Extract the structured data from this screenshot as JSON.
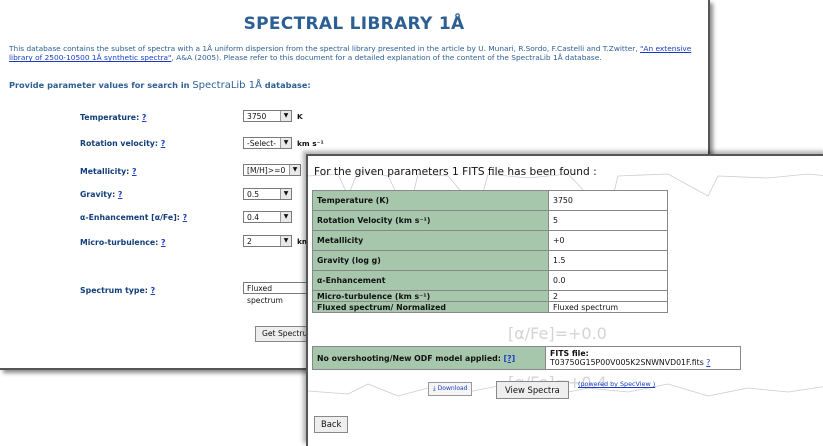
{
  "library": {
    "title": "SPECTRAL LIBRARY 1Å",
    "intro_prefix": "This database contains the subset of spectra with a 1Å uniform dispersion from the spectral library presented in the article by U. Munari, R.Sordo, F.Castelli and T.Zwitter,",
    "intro_link": "\"An extensive library of 2500-10500 1Å synthetic spectra\"",
    "intro_suffix": ", A&A (2005). Please refer to this document for a detailed explanation of the content of the SpectraLib 1Å database.",
    "prompt_prefix": "Provide parameter values for search in ",
    "prompt_lib": "SpectraLib 1Å",
    "prompt_suffix": " database:",
    "help_mark": "?",
    "params": [
      {
        "label": "Temperature:",
        "value": "3750",
        "unit": "K"
      },
      {
        "label": "Rotation velocity:",
        "value": "-Select-",
        "unit": "km s⁻¹"
      },
      {
        "label": "Metallicity:",
        "value": "[M/H]>=0",
        "unit": ""
      },
      {
        "label": "Gravity:",
        "value": "0.5",
        "unit": ""
      },
      {
        "label": "α-Enhancement [α/Fe]:",
        "value": "0.4",
        "unit": ""
      },
      {
        "label": "Micro-turbulence:",
        "value": "2",
        "unit": "km"
      },
      {
        "label": "Spectrum type:",
        "value": "Fluxed spectrum",
        "unit": ""
      }
    ],
    "get_button": "Get Spectru"
  },
  "results": {
    "header": "For the given parameters 1 FITS file has been found :",
    "rows": [
      {
        "key": "Temperature (K)",
        "value": "3750"
      },
      {
        "key": "Rotation Velocity (km s⁻¹)",
        "value": "5"
      },
      {
        "key": "Metallicity",
        "value": "+0"
      },
      {
        "key": "Gravity (log g)",
        "value": "1.5"
      },
      {
        "key": "α-Enhancement",
        "value": "0.0"
      },
      {
        "key": "Micro-turbulence (km s⁻¹)",
        "value": "2"
      },
      {
        "key": "Fluxed spectrum/ Normalized",
        "value": "Fluxed spectrum"
      }
    ],
    "odf_label": "No overshooting/New ODF model applied:",
    "odf_help": "[?]",
    "fits_label": "FITS file:",
    "fits_name": "T03750G15P00V005K2SNWNVD01F.fits",
    "fits_help": "?",
    "download_label": "Download",
    "view_button": "View Spectra",
    "powered_label": "(powered by SpecView )",
    "back_button": "Back"
  },
  "background_text": {
    "fe_a": "[α/Fe]=+0.0",
    "fe_b": "[α/Fe]=+0.4"
  }
}
